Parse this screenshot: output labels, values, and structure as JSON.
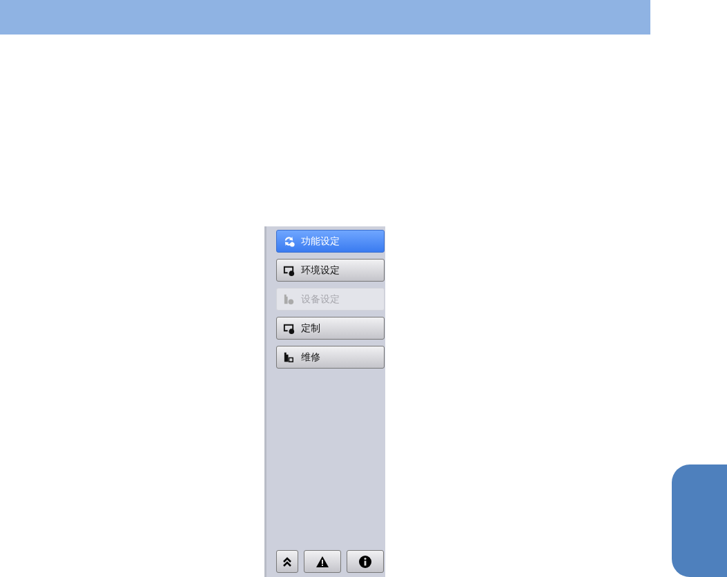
{
  "menu": {
    "items": [
      {
        "label": "功能设定",
        "selected": true,
        "disabled": false
      },
      {
        "label": "环境设定",
        "selected": false,
        "disabled": false
      },
      {
        "label": "设备设定",
        "selected": false,
        "disabled": true
      },
      {
        "label": "定制",
        "selected": false,
        "disabled": false
      },
      {
        "label": "维修",
        "selected": false,
        "disabled": false
      }
    ]
  }
}
